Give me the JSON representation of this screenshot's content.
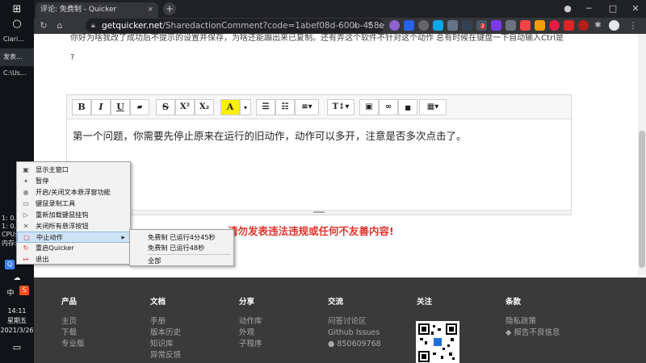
{
  "browser": {
    "tab_title": "评论: 免费制 - Quicker",
    "url_host": "getquicker.net",
    "url_path": "/SharedactionComment?code=1abef08d-600b-458e-4ff7-0...",
    "new_tab": "+",
    "ext_badge": "2"
  },
  "taskbar": {
    "apps": [
      "Clari...",
      "发表...",
      "C:\\Us..."
    ],
    "stats": [
      "1: 0.0",
      "1: 0.1",
      "CPU:",
      "内存:"
    ],
    "time": "14:11",
    "weekday": "星期五",
    "date": "2021/3/26",
    "ime": "中"
  },
  "page": {
    "question_text": "你好为啥我改了成功后不提示的设置并保存，为啥还能蹦出来已复制。还有弄这个软件不针对这个动作 总有时候在键盘一下自动输入Ctrl是",
    "question_mark": "?",
    "editor_text": "第一个问题，你需要先停止原来在运行的旧动作，动作可以多开，注意是否多次点击了。",
    "warning": "请勿发表违法违规或任何不友善内容!"
  },
  "toolbar": {
    "bold": "B",
    "italic": "I",
    "underline": "U",
    "eraser": "▰",
    "strike": "S",
    "superscript": "X²",
    "subscript": "X₂",
    "font_color": "A",
    "dropdown": "▾",
    "ul": "☰",
    "ol": "☷",
    "align": "≡▾",
    "text_size": "T↕▾",
    "image": "▣",
    "link": "∞",
    "video": "■",
    "table": "▦▾"
  },
  "context_menu": {
    "items": [
      {
        "label": "显示主窗口",
        "icon": "window-icon"
      },
      {
        "label": "暂停",
        "icon": "pause-icon"
      },
      {
        "label": "开启/关闭文本悬浮窗功能",
        "icon": "circle-icon"
      },
      {
        "label": "键鼠录制工具",
        "icon": "record-icon"
      },
      {
        "label": "重新加载键鼠挂钩",
        "icon": "play-icon"
      },
      {
        "label": "关闭所有悬浮按钮",
        "icon": "close-icon"
      },
      {
        "label": "中止动作",
        "icon": "stop-icon",
        "highlighted": true,
        "arrow": "▶"
      },
      {
        "label": "重启Quicker",
        "icon": "restart-icon"
      },
      {
        "label": "退出",
        "icon": "exit-icon"
      }
    ],
    "submenu": [
      "免费制 已运行4分45秒",
      "免费制 已运行48秒",
      "全部"
    ]
  },
  "footer": {
    "columns": [
      {
        "title": "产品",
        "items": [
          "主页",
          "下载",
          "专业版"
        ]
      },
      {
        "title": "文档",
        "items": [
          "手册",
          "版本历史",
          "知识库",
          "异常反馈"
        ]
      },
      {
        "title": "分享",
        "items": [
          "动作库",
          "外观",
          "子程序"
        ]
      },
      {
        "title": "交流",
        "items": [
          "问答讨论区",
          "Github Issues",
          "850609768"
        ]
      },
      {
        "title": "关注",
        "items": []
      },
      {
        "title": "条款",
        "items": [
          "隐私政策",
          "报告不良信息"
        ]
      }
    ]
  },
  "colors": {
    "warning": "#e0342c",
    "footer_bg": "#3a3a3a",
    "highlight": "#cfe3f7"
  }
}
